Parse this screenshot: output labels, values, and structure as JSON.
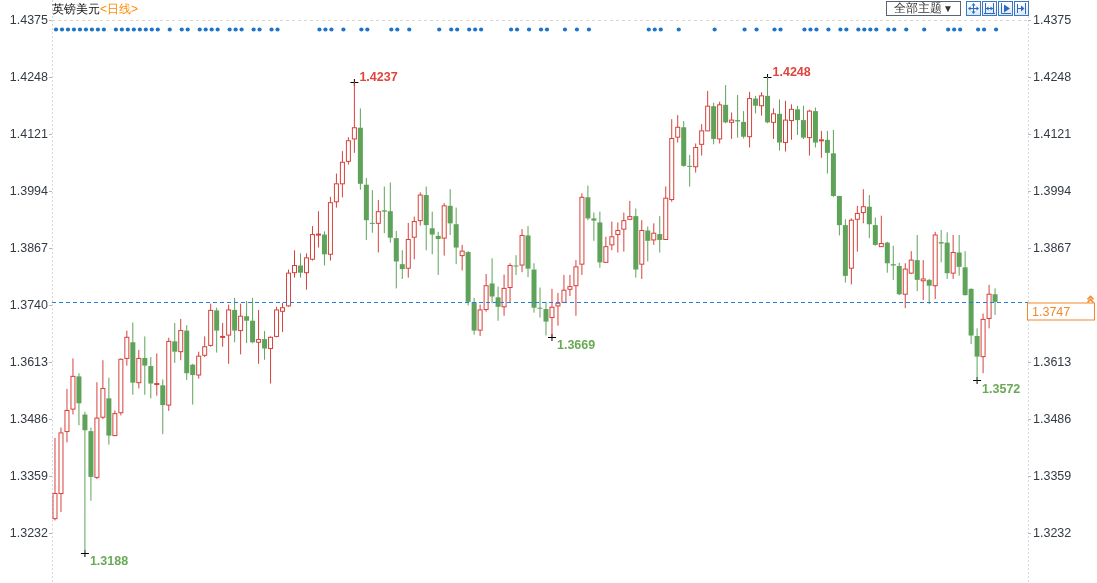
{
  "header": {
    "title": "英镑美元",
    "period": "<日线>"
  },
  "toolbar": {
    "theme_dropdown": {
      "label": "全部主题",
      "caret": "▼"
    }
  },
  "event_row": [
    {
      "marked": true
    },
    {
      "marked": true
    },
    {
      "marked": true
    },
    {
      "marked": true
    },
    {
      "marked": true
    },
    {
      "marked": true
    },
    {
      "marked": true
    },
    {
      "marked": true
    },
    {
      "marked": true
    },
    {
      "marked": false
    },
    {
      "marked": true
    },
    {
      "marked": true
    },
    {
      "marked": true
    },
    {
      "marked": true
    },
    {
      "marked": true
    },
    {
      "marked": true
    },
    {
      "marked": true
    },
    {
      "marked": true
    },
    {
      "marked": false
    },
    {
      "marked": true
    },
    {
      "marked": false
    },
    {
      "marked": true
    },
    {
      "marked": true
    },
    {
      "marked": false
    },
    {
      "marked": true
    },
    {
      "marked": true
    },
    {
      "marked": true
    },
    {
      "marked": true
    },
    {
      "marked": false
    },
    {
      "marked": true
    },
    {
      "marked": true
    },
    {
      "marked": true
    },
    {
      "marked": false
    },
    {
      "marked": true
    },
    {
      "marked": true
    },
    {
      "marked": false
    },
    {
      "marked": true
    },
    {
      "marked": true
    },
    {
      "marked": false
    },
    {
      "marked": false
    },
    {
      "marked": false
    },
    {
      "marked": false
    },
    {
      "marked": false
    },
    {
      "marked": false
    },
    {
      "marked": true
    },
    {
      "marked": true
    },
    {
      "marked": true
    },
    {
      "marked": false
    },
    {
      "marked": true
    },
    {
      "marked": false
    },
    {
      "marked": false
    },
    {
      "marked": true
    },
    {
      "marked": true
    },
    {
      "marked": false
    },
    {
      "marked": false
    },
    {
      "marked": false
    },
    {
      "marked": true
    },
    {
      "marked": true
    },
    {
      "marked": false
    },
    {
      "marked": true
    },
    {
      "marked": false
    },
    {
      "marked": false
    },
    {
      "marked": false
    },
    {
      "marked": false
    },
    {
      "marked": true
    },
    {
      "marked": false
    },
    {
      "marked": true
    },
    {
      "marked": true
    },
    {
      "marked": false
    },
    {
      "marked": true
    },
    {
      "marked": true
    },
    {
      "marked": true
    },
    {
      "marked": false
    },
    {
      "marked": false
    },
    {
      "marked": false
    },
    {
      "marked": false
    },
    {
      "marked": true
    },
    {
      "marked": true
    },
    {
      "marked": false
    },
    {
      "marked": true
    },
    {
      "marked": false
    },
    {
      "marked": true
    },
    {
      "marked": true
    },
    {
      "marked": false
    },
    {
      "marked": false
    },
    {
      "marked": true
    },
    {
      "marked": false
    },
    {
      "marked": true
    },
    {
      "marked": false
    },
    {
      "marked": true
    },
    {
      "marked": false
    },
    {
      "marked": false
    },
    {
      "marked": false
    },
    {
      "marked": false
    },
    {
      "marked": false
    },
    {
      "marked": false
    },
    {
      "marked": false
    },
    {
      "marked": false
    },
    {
      "marked": false
    },
    {
      "marked": true
    },
    {
      "marked": true
    },
    {
      "marked": true
    },
    {
      "marked": false
    },
    {
      "marked": false
    },
    {
      "marked": true
    },
    {
      "marked": false
    },
    {
      "marked": false
    },
    {
      "marked": false
    },
    {
      "marked": false
    },
    {
      "marked": false
    },
    {
      "marked": true
    },
    {
      "marked": false
    },
    {
      "marked": false
    },
    {
      "marked": false
    },
    {
      "marked": false
    },
    {
      "marked": true
    },
    {
      "marked": false
    },
    {
      "marked": true
    },
    {
      "marked": false
    },
    {
      "marked": false
    },
    {
      "marked": true
    },
    {
      "marked": true
    },
    {
      "marked": false
    },
    {
      "marked": false
    },
    {
      "marked": false
    },
    {
      "marked": true
    },
    {
      "marked": true
    },
    {
      "marked": true
    },
    {
      "marked": false
    },
    {
      "marked": true
    },
    {
      "marked": false
    },
    {
      "marked": true
    },
    {
      "marked": true
    },
    {
      "marked": false
    },
    {
      "marked": true
    },
    {
      "marked": true
    },
    {
      "marked": true
    },
    {
      "marked": true
    },
    {
      "marked": false
    },
    {
      "marked": true
    },
    {
      "marked": true
    },
    {
      "marked": false
    },
    {
      "marked": true
    },
    {
      "marked": false
    },
    {
      "marked": false
    },
    {
      "marked": true
    },
    {
      "marked": false
    },
    {
      "marked": false
    },
    {
      "marked": false
    },
    {
      "marked": true
    },
    {
      "marked": true
    },
    {
      "marked": true
    },
    {
      "marked": false
    },
    {
      "marked": false
    },
    {
      "marked": true
    },
    {
      "marked": true
    },
    {
      "marked": false
    },
    {
      "marked": true
    }
  ],
  "right_axis": {
    "labels": [
      "1.4375",
      "1.4248",
      "1.4121",
      "1.3994",
      "1.3867",
      "1.3613",
      "1.3486",
      "1.3359",
      "1.3232"
    ]
  },
  "chart": {
    "chart_data": {
      "type": "candlestick",
      "ylim": [
        1.31206,
        1.44196
      ],
      "yticks": [
        {
          "value": 1.4375,
          "label": "1.4375"
        },
        {
          "value": 1.4248,
          "label": "1.4248"
        },
        {
          "value": 1.4121,
          "label": "1.4121"
        },
        {
          "value": 1.3994,
          "label": "1.3994"
        },
        {
          "value": 1.3867,
          "label": "1.3867"
        },
        {
          "value": 1.374,
          "label": "1.3740"
        },
        {
          "value": 1.3613,
          "label": "1.3613"
        },
        {
          "value": 1.3486,
          "label": "1.3486"
        },
        {
          "value": 1.3359,
          "label": "1.3359"
        },
        {
          "value": 1.3232,
          "label": "1.3232"
        }
      ],
      "categories": [
        null,
        null,
        null,
        null,
        null,
        null,
        null,
        null,
        null,
        null,
        null,
        null,
        null,
        null,
        null,
        null,
        null,
        null,
        null,
        null,
        null,
        null,
        null,
        null,
        null,
        null,
        null,
        null,
        null,
        null,
        null,
        null,
        null,
        null,
        null,
        null,
        null,
        null,
        null,
        null,
        null,
        null,
        null,
        null,
        null,
        null,
        null,
        null,
        null,
        null,
        null,
        null,
        null,
        null,
        null,
        null,
        null,
        null,
        null,
        null,
        null,
        null,
        null,
        null,
        null,
        null,
        null,
        null,
        null,
        null,
        null,
        null,
        null,
        null,
        null,
        null,
        null,
        null,
        null,
        null,
        null,
        null,
        null,
        null,
        null,
        null,
        null,
        null,
        null,
        null,
        null,
        null,
        null,
        null,
        null,
        null,
        null,
        null,
        null,
        null,
        null,
        null,
        null,
        null,
        null,
        null,
        null,
        null,
        null,
        null,
        null,
        null,
        null,
        null,
        null,
        null,
        null,
        null,
        null,
        null,
        null,
        null,
        null,
        null,
        null,
        null,
        null,
        null,
        null,
        null,
        null,
        null,
        null,
        null,
        null,
        null,
        null,
        null,
        null,
        null,
        null,
        null,
        null,
        null,
        null,
        null,
        null,
        null,
        null,
        null,
        null,
        null,
        null,
        null,
        null,
        null,
        null,
        null,
        null,
        null,
        null,
        null,
        null
      ],
      "ohlc": [
        [
          1.3264,
          1.3444,
          1.326,
          1.332
        ],
        [
          1.332,
          1.3467,
          1.3279,
          1.3455
        ],
        [
          1.3458,
          1.3553,
          1.3434,
          1.3505
        ],
        [
          1.3508,
          1.3621,
          1.3496,
          1.3581
        ],
        [
          1.3581,
          1.3588,
          1.3472,
          1.3521
        ],
        [
          1.3496,
          1.3502,
          1.3188,
          1.3461
        ],
        [
          1.3459,
          1.3467,
          1.3304,
          1.3357
        ],
        [
          1.3356,
          1.3568,
          1.3352,
          1.3488
        ],
        [
          1.349,
          1.3617,
          1.3486,
          1.3554
        ],
        [
          1.3532,
          1.3578,
          1.3429,
          1.3449
        ],
        [
          1.3449,
          1.3505,
          1.3448,
          1.3498
        ],
        [
          1.35,
          1.3621,
          1.3494,
          1.3619
        ],
        [
          1.3621,
          1.3683,
          1.3605,
          1.3668
        ],
        [
          1.3657,
          1.3701,
          1.354,
          1.3567
        ],
        [
          1.3567,
          1.364,
          1.3554,
          1.3621
        ],
        [
          1.3622,
          1.367,
          1.354,
          1.3605
        ],
        [
          1.3604,
          1.3624,
          1.3532,
          1.3565
        ],
        [
          1.3563,
          1.3632,
          1.3538,
          1.3565
        ],
        [
          1.3561,
          1.3574,
          1.3452,
          1.3517
        ],
        [
          1.3517,
          1.3667,
          1.3504,
          1.3659
        ],
        [
          1.3659,
          1.37,
          1.3611,
          1.3636
        ],
        [
          1.3636,
          1.3709,
          1.3617,
          1.3683
        ],
        [
          1.3683,
          1.3695,
          1.3573,
          1.3588
        ],
        [
          1.3607,
          1.3609,
          1.3518,
          1.3584
        ],
        [
          1.3584,
          1.3636,
          1.3576,
          1.3626
        ],
        [
          1.3628,
          1.367,
          1.3624,
          1.3647
        ],
        [
          1.365,
          1.3743,
          1.3647,
          1.3728
        ],
        [
          1.3728,
          1.3734,
          1.3634,
          1.3683
        ],
        [
          1.3669,
          1.37,
          1.3647,
          1.367
        ],
        [
          1.3673,
          1.3741,
          1.3609,
          1.3729
        ],
        [
          1.3729,
          1.3756,
          1.3657,
          1.3683
        ],
        [
          1.3683,
          1.3743,
          1.363,
          1.3715
        ],
        [
          1.3715,
          1.3749,
          1.3655,
          1.3705
        ],
        [
          1.3705,
          1.3756,
          1.3655,
          1.3657
        ],
        [
          1.3657,
          1.3729,
          1.3609,
          1.3663
        ],
        [
          1.3664,
          1.3682,
          1.3618,
          1.3643
        ],
        [
          1.3643,
          1.367,
          1.3565,
          1.3668
        ],
        [
          1.367,
          1.3736,
          1.3668,
          1.3729
        ],
        [
          1.3726,
          1.3745,
          1.368,
          1.3734
        ],
        [
          1.3738,
          1.3819,
          1.3736,
          1.3811
        ],
        [
          1.3812,
          1.3862,
          1.3801,
          1.3828
        ],
        [
          1.3828,
          1.3855,
          1.3801,
          1.3812
        ],
        [
          1.3812,
          1.3855,
          1.3774,
          1.3845
        ],
        [
          1.3842,
          1.3916,
          1.3839,
          1.3897
        ],
        [
          1.3896,
          1.3949,
          1.3868,
          1.3898
        ],
        [
          1.3897,
          1.3904,
          1.3828,
          1.3853
        ],
        [
          1.3853,
          1.3981,
          1.3839,
          1.3968
        ],
        [
          1.397,
          1.4033,
          1.3957,
          1.401
        ],
        [
          1.401,
          1.4083,
          1.398,
          1.4058
        ],
        [
          1.406,
          1.4114,
          1.4053,
          1.4106
        ],
        [
          1.411,
          1.4237,
          1.4079,
          1.4135
        ],
        [
          1.4135,
          1.4178,
          1.3997,
          1.401
        ],
        [
          1.4008,
          1.4023,
          1.3885,
          1.3929
        ],
        [
          1.3923,
          1.3996,
          1.3901,
          1.3922
        ],
        [
          1.3922,
          1.3974,
          1.3857,
          1.3948
        ],
        [
          1.3951,
          1.4004,
          1.39,
          1.3948
        ],
        [
          1.3949,
          1.4013,
          1.3879,
          1.389
        ],
        [
          1.3889,
          1.3905,
          1.3777,
          1.3837
        ],
        [
          1.3831,
          1.3862,
          1.3798,
          1.382
        ],
        [
          1.3822,
          1.3923,
          1.3801,
          1.3886
        ],
        [
          1.3891,
          1.3937,
          1.3842,
          1.3926
        ],
        [
          1.3928,
          1.3991,
          1.3917,
          1.3985
        ],
        [
          1.3985,
          1.4004,
          1.3862,
          1.3918
        ],
        [
          1.3911,
          1.3948,
          1.3853,
          1.3897
        ],
        [
          1.3894,
          1.3903,
          1.3807,
          1.3887
        ],
        [
          1.3889,
          1.3967,
          1.385,
          1.3961
        ],
        [
          1.3961,
          1.3998,
          1.3896,
          1.3922
        ],
        [
          1.392,
          1.3957,
          1.3831,
          1.3868
        ],
        [
          1.385,
          1.3874,
          1.3817,
          1.386
        ],
        [
          1.3858,
          1.386,
          1.3739,
          1.3747
        ],
        [
          1.3746,
          1.3756,
          1.3674,
          1.3683
        ],
        [
          1.3684,
          1.3741,
          1.3671,
          1.3729
        ],
        [
          1.373,
          1.3809,
          1.3725,
          1.3783
        ],
        [
          1.3788,
          1.3844,
          1.3744,
          1.3759
        ],
        [
          1.3757,
          1.3781,
          1.3705,
          1.3736
        ],
        [
          1.3736,
          1.3808,
          1.3716,
          1.3777
        ],
        [
          1.3779,
          1.3833,
          1.3746,
          1.3828
        ],
        [
          1.3828,
          1.3851,
          1.3807,
          1.3827
        ],
        [
          1.3829,
          1.3909,
          1.3813,
          1.3895
        ],
        [
          1.3895,
          1.3916,
          1.3802,
          1.3821
        ],
        [
          1.3819,
          1.3833,
          1.3723,
          1.3734
        ],
        [
          1.3734,
          1.3779,
          1.3712,
          1.3732
        ],
        [
          1.3731,
          1.3747,
          1.3672,
          1.3703
        ],
        [
          1.3712,
          1.3776,
          1.3669,
          1.3735
        ],
        [
          1.3738,
          1.3767,
          1.3694,
          1.3744
        ],
        [
          1.3746,
          1.3807,
          1.3744,
          1.3773
        ],
        [
          1.3775,
          1.3807,
          1.376,
          1.3781
        ],
        [
          1.3783,
          1.384,
          1.3716,
          1.3825
        ],
        [
          1.3831,
          1.3989,
          1.3807,
          1.398
        ],
        [
          1.398,
          1.4006,
          1.3929,
          1.3933
        ],
        [
          1.3933,
          1.3946,
          1.3883,
          1.3928
        ],
        [
          1.3924,
          1.3948,
          1.3823,
          1.3835
        ],
        [
          1.3835,
          1.3892,
          1.3834,
          1.387
        ],
        [
          1.3874,
          1.3926,
          1.3862,
          1.3892
        ],
        [
          1.3897,
          1.3924,
          1.3857,
          1.3906
        ],
        [
          1.3909,
          1.3946,
          1.3859,
          1.3928
        ],
        [
          1.3931,
          1.3972,
          1.3929,
          1.3937
        ],
        [
          1.3938,
          1.3955,
          1.3801,
          1.3819
        ],
        [
          1.3831,
          1.3929,
          1.3798,
          1.3906
        ],
        [
          1.3906,
          1.3915,
          1.3837,
          1.3883
        ],
        [
          1.3885,
          1.3922,
          1.3874,
          1.39
        ],
        [
          1.3898,
          1.3938,
          1.3857,
          1.3885
        ],
        [
          1.3886,
          1.4004,
          1.3885,
          1.3978
        ],
        [
          1.3975,
          1.4154,
          1.397,
          1.4111
        ],
        [
          1.4114,
          1.4163,
          1.4102,
          1.4136
        ],
        [
          1.4136,
          1.415,
          1.4048,
          1.405
        ],
        [
          1.405,
          1.4074,
          1.4004,
          1.4048
        ],
        [
          1.4048,
          1.41,
          1.4035,
          1.4091
        ],
        [
          1.4098,
          1.4143,
          1.4073,
          1.4128
        ],
        [
          1.4128,
          1.4217,
          1.4128,
          1.4183
        ],
        [
          1.4183,
          1.4191,
          1.4098,
          1.411
        ],
        [
          1.411,
          1.4193,
          1.41,
          1.4186
        ],
        [
          1.4186,
          1.423,
          1.4145,
          1.4147
        ],
        [
          1.4147,
          1.4169,
          1.411,
          1.4152
        ],
        [
          1.4152,
          1.4208,
          1.4113,
          1.4149
        ],
        [
          1.4148,
          1.4172,
          1.4111,
          1.4115
        ],
        [
          1.4115,
          1.4215,
          1.4091,
          1.42
        ],
        [
          1.42,
          1.4206,
          1.4167,
          1.4184
        ],
        [
          1.4184,
          1.4214,
          1.4162,
          1.4206
        ],
        [
          1.4206,
          1.4248,
          1.4145,
          1.4147
        ],
        [
          1.4147,
          1.4178,
          1.411,
          1.4166
        ],
        [
          1.4166,
          1.4198,
          1.4084,
          1.4102
        ],
        [
          1.4102,
          1.4195,
          1.4082,
          1.4152
        ],
        [
          1.4151,
          1.4187,
          1.4108,
          1.4176
        ],
        [
          1.4176,
          1.4184,
          1.4119,
          1.4152
        ],
        [
          1.4152,
          1.4184,
          1.411,
          1.4113
        ],
        [
          1.4113,
          1.4175,
          1.4073,
          1.4172
        ],
        [
          1.4172,
          1.418,
          1.4091,
          1.4102
        ],
        [
          1.4106,
          1.4128,
          1.4068,
          1.4108
        ],
        [
          1.4108,
          1.4128,
          1.4033,
          1.4079
        ],
        [
          1.4078,
          1.413,
          1.3981,
          1.3983
        ],
        [
          1.3983,
          1.3983,
          1.3895,
          1.3918
        ],
        [
          1.3918,
          1.3931,
          1.379,
          1.3805
        ],
        [
          1.3822,
          1.3933,
          1.3786,
          1.3929
        ],
        [
          1.3931,
          1.3961,
          1.3859,
          1.3944
        ],
        [
          1.3946,
          1.3998,
          1.3922,
          1.3959
        ],
        [
          1.3959,
          1.3985,
          1.3889,
          1.392
        ],
        [
          1.3918,
          1.3935,
          1.3872,
          1.3874
        ],
        [
          1.387,
          1.3939,
          1.387,
          1.3877
        ],
        [
          1.3879,
          1.3881,
          1.3812,
          1.3833
        ],
        [
          1.3831,
          1.3872,
          1.3796,
          1.3828
        ],
        [
          1.3827,
          1.3834,
          1.3762,
          1.3764
        ],
        [
          1.3764,
          1.3833,
          1.3733,
          1.382
        ],
        [
          1.3811,
          1.386,
          1.3809,
          1.384
        ],
        [
          1.384,
          1.3896,
          1.3771,
          1.3796
        ],
        [
          1.3794,
          1.384,
          1.3751,
          1.3798
        ],
        [
          1.3796,
          1.3798,
          1.3742,
          1.3783
        ],
        [
          1.3783,
          1.3903,
          1.3753,
          1.3896
        ],
        [
          1.388,
          1.3907,
          1.3835,
          1.3877
        ],
        [
          1.3879,
          1.3902,
          1.3798,
          1.3811
        ],
        [
          1.3811,
          1.3896,
          1.3798,
          1.3857
        ],
        [
          1.3857,
          1.3896,
          1.3805,
          1.3825
        ],
        [
          1.3824,
          1.386,
          1.3761,
          1.3762
        ],
        [
          1.3776,
          1.3777,
          1.3653,
          1.3672
        ],
        [
          1.3671,
          1.3688,
          1.3572,
          1.3625
        ],
        [
          1.3625,
          1.3721,
          1.3588,
          1.3708
        ],
        [
          1.371,
          1.3785,
          1.3688,
          1.3764
        ],
        [
          1.3764,
          1.3777,
          1.3718,
          1.3747
        ],
        null,
        null,
        null,
        null,
        null
      ],
      "annotations": [
        "1.3188",
        "1.4237",
        "1.3669",
        "1.4248",
        "1.3572"
      ],
      "ref_lines": [
        {
          "axis": "y",
          "value": 1.3747,
          "label": "1.3747"
        }
      ]
    }
  }
}
